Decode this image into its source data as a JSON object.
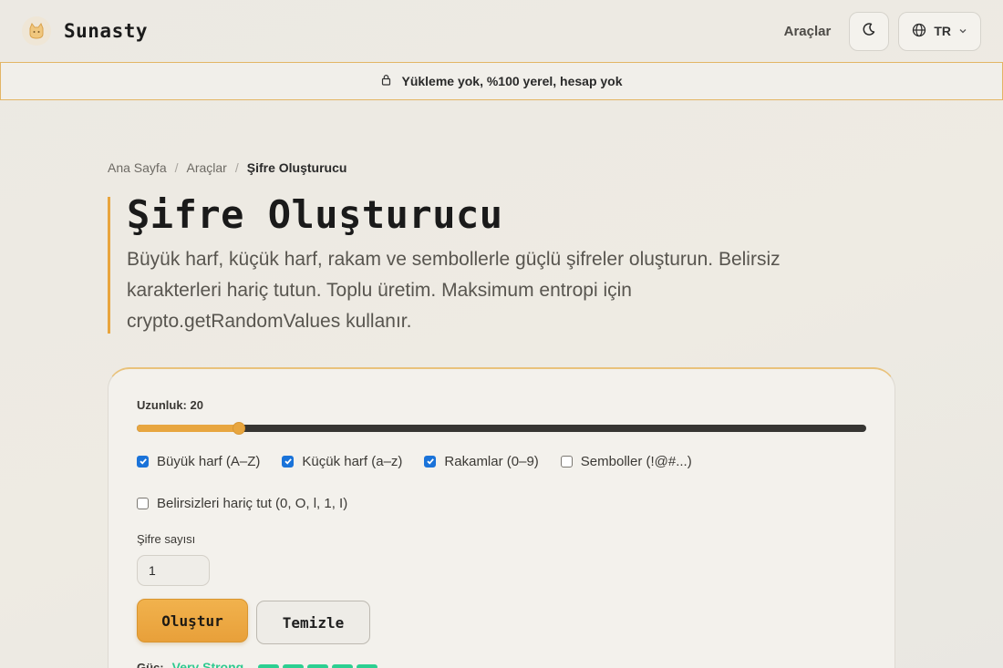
{
  "header": {
    "brand": "Sunasty",
    "nav_link": "Araçlar",
    "theme_icon": "moon-icon",
    "lang": "TR"
  },
  "banner": {
    "icon": "lock-icon",
    "text": "Yükleme yok, %100 yerel, hesap yok"
  },
  "breadcrumb": {
    "items": [
      "Ana Sayfa",
      "Araçlar",
      "Şifre Oluşturucu"
    ],
    "separator": "/"
  },
  "hero": {
    "title": "Şifre Oluşturucu",
    "description": "Büyük harf, küçük harf, rakam ve sembollerle güçlü şifreler oluşturun. Belirsiz karakterleri hariç tutun. Toplu üretim. Maksimum entropi için crypto.getRandomValues kullanır."
  },
  "generator": {
    "length_label": "Uzunluk: 20",
    "length_fraction": 0.14,
    "options": [
      {
        "label": "Büyük harf (A–Z)",
        "checked": true
      },
      {
        "label": "Küçük harf (a–z)",
        "checked": true
      },
      {
        "label": "Rakamlar (0–9)",
        "checked": true
      },
      {
        "label": "Semboller (!@#...)",
        "checked": false
      },
      {
        "label": "Belirsizleri hariç tut (0, O, l, 1, I)",
        "checked": false
      }
    ],
    "count_label": "Şifre sayısı",
    "count_value": "1",
    "generate_label": "Oluştur",
    "clear_label": "Temizle",
    "strength_label": "Güç:",
    "strength_value": "Very Strong",
    "strength_bars": 5,
    "colors": {
      "accent": "#e8a63f",
      "strength": "#2ccf91",
      "checkbox": "#1a73d9"
    }
  }
}
